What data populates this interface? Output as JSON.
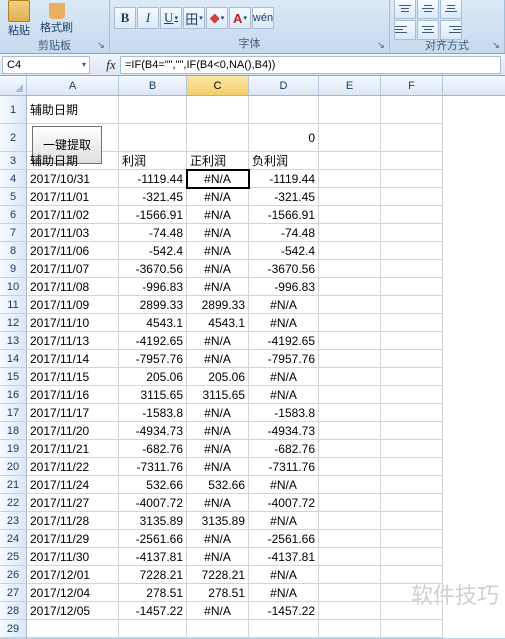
{
  "ribbon": {
    "group_clipboard": "剪贴板",
    "group_font": "字体",
    "group_align": "对齐方式",
    "paste": "粘贴",
    "fmt_paint": "格式刷"
  },
  "namebox": "C4",
  "formula": "=IF(B4=\"\",\"\",IF(B4<0,NA(),B4))",
  "columns": [
    "A",
    "B",
    "C",
    "D",
    "E",
    "F"
  ],
  "title_cell": "辅助日期",
  "button_label": "一键提取",
  "zero_val": "0",
  "headers": {
    "A": "辅助日期",
    "B": "利润",
    "C": "正利润",
    "D": "负利润"
  },
  "watermark": "软件技巧",
  "chart_data": {
    "type": "table",
    "columns": [
      "辅助日期",
      "利润",
      "正利润",
      "负利润"
    ],
    "rows": [
      [
        "2017/10/31",
        -1119.44,
        "#N/A",
        -1119.44
      ],
      [
        "2017/11/01",
        -321.45,
        "#N/A",
        -321.45
      ],
      [
        "2017/11/02",
        -1566.91,
        "#N/A",
        -1566.91
      ],
      [
        "2017/11/03",
        -74.48,
        "#N/A",
        -74.48
      ],
      [
        "2017/11/06",
        -542.4,
        "#N/A",
        -542.4
      ],
      [
        "2017/11/07",
        -3670.56,
        "#N/A",
        -3670.56
      ],
      [
        "2017/11/08",
        -996.83,
        "#N/A",
        -996.83
      ],
      [
        "2017/11/09",
        2899.33,
        2899.33,
        "#N/A"
      ],
      [
        "2017/11/10",
        4543.1,
        4543.1,
        "#N/A"
      ],
      [
        "2017/11/13",
        -4192.65,
        "#N/A",
        -4192.65
      ],
      [
        "2017/11/14",
        -7957.76,
        "#N/A",
        -7957.76
      ],
      [
        "2017/11/15",
        205.06,
        205.06,
        "#N/A"
      ],
      [
        "2017/11/16",
        3115.65,
        3115.65,
        "#N/A"
      ],
      [
        "2017/11/17",
        -1583.8,
        "#N/A",
        -1583.8
      ],
      [
        "2017/11/20",
        -4934.73,
        "#N/A",
        -4934.73
      ],
      [
        "2017/11/21",
        -682.76,
        "#N/A",
        -682.76
      ],
      [
        "2017/11/22",
        -7311.76,
        "#N/A",
        -7311.76
      ],
      [
        "2017/11/24",
        532.66,
        532.66,
        "#N/A"
      ],
      [
        "2017/11/27",
        -4007.72,
        "#N/A",
        -4007.72
      ],
      [
        "2017/11/28",
        3135.89,
        3135.89,
        "#N/A"
      ],
      [
        "2017/11/29",
        -2561.66,
        "#N/A",
        -2561.66
      ],
      [
        "2017/11/30",
        -4137.81,
        "#N/A",
        -4137.81
      ],
      [
        "2017/12/01",
        7228.21,
        7228.21,
        "#N/A"
      ],
      [
        "2017/12/04",
        278.51,
        278.51,
        "#N/A"
      ],
      [
        "2017/12/05",
        -1457.22,
        "#N/A",
        -1457.22
      ]
    ]
  }
}
